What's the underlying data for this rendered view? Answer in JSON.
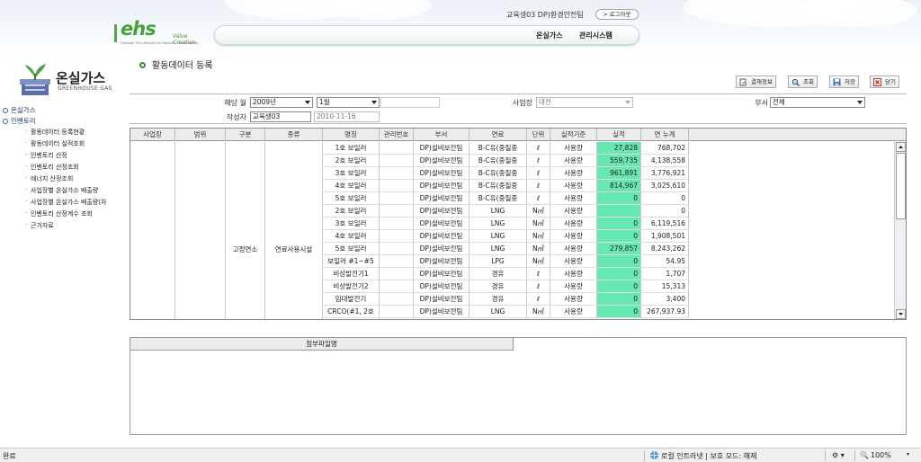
{
  "header": {
    "logo_text": "ehs",
    "logo_tagline": "Value Creation",
    "logo_subline": "Hankook Tire Lifestyle For Health & Sustainability",
    "user_info": "교육생03 DP)환경안전팀",
    "logout_label": "로그아웃",
    "nav": [
      "온실가스",
      "관리시스템"
    ]
  },
  "sidebar": {
    "brand_ko": "온실가스",
    "brand_en": "GREENHOUSE GAS",
    "sections": [
      {
        "label": "온실가스"
      },
      {
        "label": "인벤토리"
      }
    ],
    "items": [
      "활동데이터 등록현황",
      "활동데이터 실적조회",
      "인벤토리 산정",
      "인벤토리 산정조회",
      "에너지 산정조회",
      "사업장별 온실가스 배출량",
      "사업장별 온실가스 배출량(차",
      "인벤토리 산정계수 조회",
      "근거자료"
    ]
  },
  "page": {
    "title": "활동데이터 등록"
  },
  "toolbar": {
    "approval": "결재정보",
    "search": "조회",
    "save": "저장",
    "close": "닫기"
  },
  "filters": {
    "period_label": "해당 월",
    "year": "2009년",
    "month": "1월",
    "site_label": "사업장",
    "site": "대전",
    "dept_label": "부서",
    "dept": "전체",
    "author_label": "작성자",
    "author": "교육생03",
    "date": "2010-11-16"
  },
  "grid": {
    "columns": [
      "사업장",
      "범위",
      "구분",
      "종류",
      "명칭",
      "관리번호",
      "부서",
      "연료",
      "단위",
      "실적기준",
      "실적",
      "연 누계"
    ],
    "group": {
      "category": "고정연소",
      "kind": "연료사용시설"
    },
    "rows": [
      {
        "name": "1호 보일러",
        "dept": "DP)설비보전팀",
        "fuel": "B-C유(중질중",
        "unit": "ℓ",
        "basis": "사용량",
        "actual": "27,828",
        "cum": "768,702"
      },
      {
        "name": "2호 보일러",
        "dept": "DP)설비보전팀",
        "fuel": "B-C유(중질중",
        "unit": "ℓ",
        "basis": "사용량",
        "actual": "559,735",
        "cum": "4,138,558"
      },
      {
        "name": "3호 보일러",
        "dept": "DP)설비보전팀",
        "fuel": "B-C유(중질중",
        "unit": "ℓ",
        "basis": "사용량",
        "actual": "961,891",
        "cum": "3,776,921"
      },
      {
        "name": "4호 보일러",
        "dept": "DP)설비보전팀",
        "fuel": "B-C유(중질중",
        "unit": "ℓ",
        "basis": "사용량",
        "actual": "814,967",
        "cum": "3,025,610"
      },
      {
        "name": "5호 보일러",
        "dept": "DP)설비보전팀",
        "fuel": "B-C유(중질중",
        "unit": "ℓ",
        "basis": "사용량",
        "actual": "0",
        "cum": "0"
      },
      {
        "name": "2호 보일러",
        "dept": "DP)설비보전팀",
        "fuel": "LNG",
        "unit": "N㎥",
        "basis": "사용량",
        "actual": "",
        "cum": "0"
      },
      {
        "name": "3호 보일러",
        "dept": "DP)설비보전팀",
        "fuel": "LNG",
        "unit": "N㎥",
        "basis": "사용량",
        "actual": "0",
        "cum": "6,119,516"
      },
      {
        "name": "4호 보일러",
        "dept": "DP)설비보전팀",
        "fuel": "LNG",
        "unit": "N㎥",
        "basis": "사용량",
        "actual": "0",
        "cum": "1,908,501"
      },
      {
        "name": "5호 보일러",
        "dept": "DP)설비보전팀",
        "fuel": "LNG",
        "unit": "N㎥",
        "basis": "사용량",
        "actual": "279,857",
        "cum": "8,243,262"
      },
      {
        "name": "보일러 #1~#5",
        "dept": "DP)설비보전팀",
        "fuel": "LPG",
        "unit": "N㎥",
        "basis": "사용량",
        "actual": "0",
        "cum": "54.95"
      },
      {
        "name": "비상발전기1",
        "dept": "DP)설비보전팀",
        "fuel": "경유",
        "unit": "ℓ",
        "basis": "사용량",
        "actual": "0",
        "cum": "1,707"
      },
      {
        "name": "비상발전기2",
        "dept": "DP)설비보전팀",
        "fuel": "경유",
        "unit": "ℓ",
        "basis": "사용량",
        "actual": "0",
        "cum": "15,313"
      },
      {
        "name": "임대발전기",
        "dept": "DP)설비보전팀",
        "fuel": "경유",
        "unit": "ℓ",
        "basis": "사용량",
        "actual": "0",
        "cum": "3,400"
      },
      {
        "name": "CRCO(#1, 2호",
        "dept": "DP)설비보전팀",
        "fuel": "LNG",
        "unit": "N㎥",
        "basis": "사용량",
        "actual": "0",
        "cum": "267,937.93"
      }
    ]
  },
  "attachments": {
    "header": "첨부파일명"
  },
  "statusbar": {
    "left": "완료",
    "zone": "로컬 인트라넷 | 보호 모드: 해제",
    "zoom": "100%"
  },
  "colors": {
    "highlight": "#66e8b0",
    "brand_green": "#48a23c"
  }
}
